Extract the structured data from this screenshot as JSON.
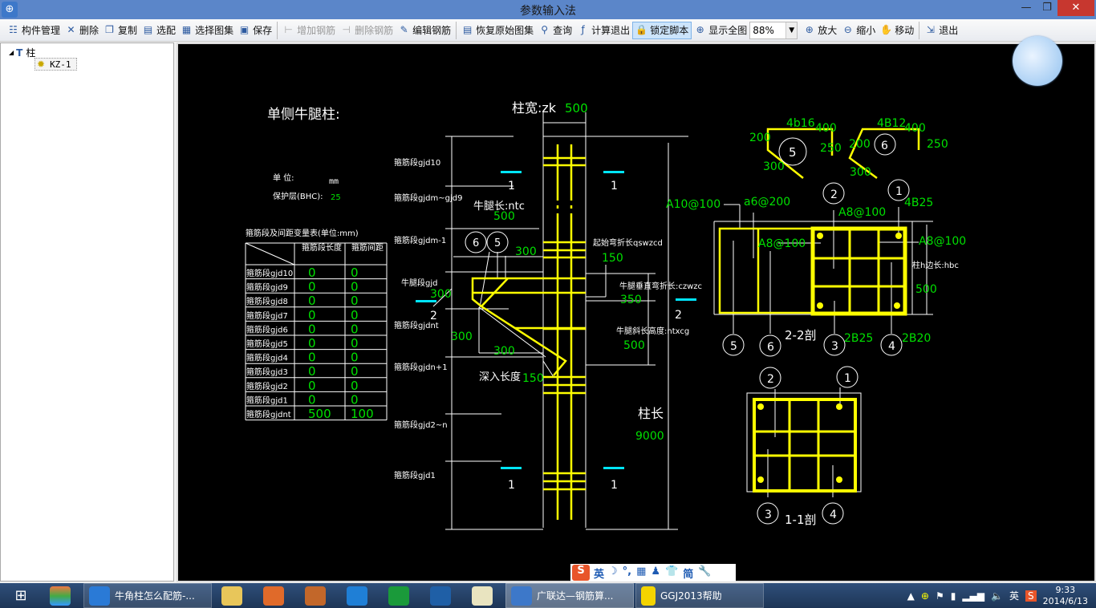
{
  "window": {
    "title": "参数输入法",
    "min": "—",
    "max": "❐",
    "close": "✕"
  },
  "toolbar": {
    "items": [
      {
        "label": "构件管理",
        "icon": "component-manage-icon",
        "ic": "☷"
      },
      {
        "label": "删除",
        "icon": "delete-icon",
        "ic": "✕"
      },
      {
        "label": "复制",
        "icon": "copy-icon",
        "ic": "❐"
      },
      {
        "label": "选配",
        "icon": "clipboard-icon",
        "ic": "▤"
      },
      {
        "label": "选择图集",
        "icon": "select-atlas-icon",
        "ic": "▦"
      },
      {
        "label": "保存",
        "icon": "save-icon",
        "ic": "▣"
      },
      {
        "label": "增加钢筋",
        "icon": "add-rebar-icon",
        "ic": "⊢",
        "disabled": true
      },
      {
        "label": "删除钢筋",
        "icon": "delete-rebar-icon",
        "ic": "⊣",
        "disabled": true
      },
      {
        "label": "编辑钢筋",
        "icon": "edit-rebar-icon",
        "ic": "✎"
      },
      {
        "label": "恢复原始图集",
        "icon": "restore-icon",
        "ic": "▤"
      },
      {
        "label": "查询",
        "icon": "binoculars-icon",
        "ic": "⚲"
      },
      {
        "label": "计算退出",
        "icon": "fx-icon",
        "ic": "ƒ"
      },
      {
        "label": "锁定脚本",
        "icon": "lock-icon",
        "ic": "🔒",
        "active": true
      },
      {
        "label": "显示全图",
        "icon": "fit-view-icon",
        "ic": "⊕"
      },
      {
        "label": "放大",
        "icon": "zoom-in-icon",
        "ic": "⊕"
      },
      {
        "label": "缩小",
        "icon": "zoom-out-icon",
        "ic": "⊖"
      },
      {
        "label": "移动",
        "icon": "pan-hand-icon",
        "ic": "✋"
      },
      {
        "label": "退出",
        "icon": "exit-icon",
        "ic": "⇲"
      }
    ],
    "zoom": "88%"
  },
  "tree": {
    "root": "柱",
    "child": "KZ-1"
  },
  "drawing": {
    "title": "单侧牛腿柱:",
    "unit_label": "单  位:",
    "unit": "mm",
    "cover_label": "保护层(BHC):",
    "cover": "25",
    "table_title": "箍筋段及间距变量表(单位:mm)",
    "table_headers": [
      "箍筋段长度",
      "箍筋间距"
    ],
    "table_rows": [
      {
        "name": "箍筋段gjd10",
        "len": "0",
        "sp": "0"
      },
      {
        "name": "箍筋段gjd9",
        "len": "0",
        "sp": "0"
      },
      {
        "name": "箍筋段gjd8",
        "len": "0",
        "sp": "0"
      },
      {
        "name": "箍筋段gjd7",
        "len": "0",
        "sp": "0"
      },
      {
        "name": "箍筋段gjd6",
        "len": "0",
        "sp": "0"
      },
      {
        "name": "箍筋段gjd5",
        "len": "0",
        "sp": "0"
      },
      {
        "name": "箍筋段gjd4",
        "len": "0",
        "sp": "0"
      },
      {
        "name": "箍筋段gjd3",
        "len": "0",
        "sp": "0"
      },
      {
        "name": "箍筋段gjd2",
        "len": "0",
        "sp": "0"
      },
      {
        "name": "箍筋段gjd1",
        "len": "0",
        "sp": "0"
      },
      {
        "name": "箍筋段gjdnt",
        "len": "500",
        "sp": "100"
      }
    ],
    "segments": [
      "箍筋段gjd10",
      "箍筋段gjdm~gjd9",
      "箍筋段gjdm-1",
      "牛腿段gjd",
      "箍筋段gjdnt",
      "箍筋段gjdn+1",
      "箍筋段gjd2~n",
      "箍筋段gjd1"
    ],
    "col_width_label": "柱宽:zk",
    "col_width": "500",
    "corbel_len_label": "牛腿长:ntc",
    "corbel_len": "500",
    "start_bend_label": "起始弯折长qswzcd",
    "start_bend": "150",
    "vert_bend_label": "牛腿垂直弯折长:czwzc",
    "vert_bend": "350",
    "slope_h_label": "牛腿斜长高度:ntxcg",
    "slope_h": "500",
    "embed_label": "深入长度",
    "embed": "150",
    "dim_300": "300",
    "gjd_300": "300",
    "col_len_label": "柱长",
    "col_len": "9000",
    "stirrup_main": "A10@100",
    "sec1": "1",
    "sec2": "2",
    "bar5": {
      "no": "5",
      "spec": "4b16",
      "a": "400",
      "b": "200",
      "c": "250",
      "d": "300"
    },
    "bar6": {
      "no": "6",
      "spec": "4B12",
      "a": "400",
      "b": "200",
      "c": "250",
      "d": "300"
    },
    "s22": {
      "title": "2-2剖",
      "a6": "a6@200",
      "a8": "A8@100",
      "b1": "4B25",
      "b3": "2B25",
      "b4": "2B20",
      "hbc_label": "柱h边长:hbc",
      "hbc": "500"
    },
    "s11": {
      "title": "1-1剖"
    },
    "marks": [
      "1",
      "2",
      "3",
      "4",
      "5",
      "6"
    ]
  },
  "ime": {
    "logo": "S",
    "lang": "英",
    "items": [
      "☽",
      "°,",
      "▦",
      "♟",
      "👕",
      "简",
      "🔧"
    ]
  },
  "taskbar": {
    "windows": [
      {
        "label": "牛角柱怎么配筋-..."
      },
      {
        "label": "广联达—钢筋算..."
      },
      {
        "label": "GGJ2013帮助"
      }
    ],
    "tray_lang": "英",
    "time": "9:33",
    "date": "2014/6/13"
  },
  "colors": {
    "rebar": "#ffff00",
    "dim_text": "#00e000",
    "section_mark": "#00e5ff",
    "canvas": "#000000"
  }
}
